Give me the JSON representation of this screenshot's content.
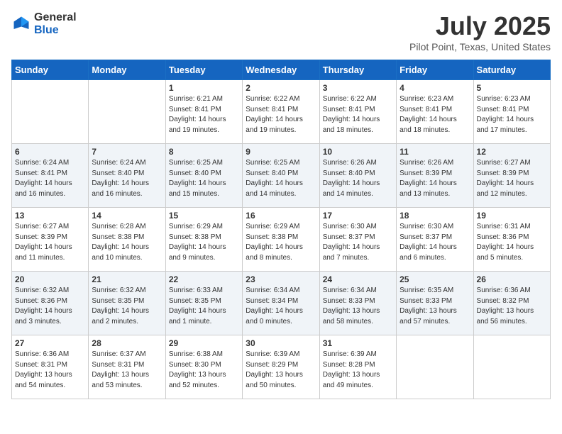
{
  "logo": {
    "text1": "General",
    "text2": "Blue"
  },
  "title": "July 2025",
  "subtitle": "Pilot Point, Texas, United States",
  "weekdays": [
    "Sunday",
    "Monday",
    "Tuesday",
    "Wednesday",
    "Thursday",
    "Friday",
    "Saturday"
  ],
  "weeks": [
    [
      {
        "day": "",
        "sunrise": "",
        "sunset": "",
        "daylight": ""
      },
      {
        "day": "",
        "sunrise": "",
        "sunset": "",
        "daylight": ""
      },
      {
        "day": "1",
        "sunrise": "Sunrise: 6:21 AM",
        "sunset": "Sunset: 8:41 PM",
        "daylight": "Daylight: 14 hours and 19 minutes."
      },
      {
        "day": "2",
        "sunrise": "Sunrise: 6:22 AM",
        "sunset": "Sunset: 8:41 PM",
        "daylight": "Daylight: 14 hours and 19 minutes."
      },
      {
        "day": "3",
        "sunrise": "Sunrise: 6:22 AM",
        "sunset": "Sunset: 8:41 PM",
        "daylight": "Daylight: 14 hours and 18 minutes."
      },
      {
        "day": "4",
        "sunrise": "Sunrise: 6:23 AM",
        "sunset": "Sunset: 8:41 PM",
        "daylight": "Daylight: 14 hours and 18 minutes."
      },
      {
        "day": "5",
        "sunrise": "Sunrise: 6:23 AM",
        "sunset": "Sunset: 8:41 PM",
        "daylight": "Daylight: 14 hours and 17 minutes."
      }
    ],
    [
      {
        "day": "6",
        "sunrise": "Sunrise: 6:24 AM",
        "sunset": "Sunset: 8:41 PM",
        "daylight": "Daylight: 14 hours and 16 minutes."
      },
      {
        "day": "7",
        "sunrise": "Sunrise: 6:24 AM",
        "sunset": "Sunset: 8:40 PM",
        "daylight": "Daylight: 14 hours and 16 minutes."
      },
      {
        "day": "8",
        "sunrise": "Sunrise: 6:25 AM",
        "sunset": "Sunset: 8:40 PM",
        "daylight": "Daylight: 14 hours and 15 minutes."
      },
      {
        "day": "9",
        "sunrise": "Sunrise: 6:25 AM",
        "sunset": "Sunset: 8:40 PM",
        "daylight": "Daylight: 14 hours and 14 minutes."
      },
      {
        "day": "10",
        "sunrise": "Sunrise: 6:26 AM",
        "sunset": "Sunset: 8:40 PM",
        "daylight": "Daylight: 14 hours and 14 minutes."
      },
      {
        "day": "11",
        "sunrise": "Sunrise: 6:26 AM",
        "sunset": "Sunset: 8:39 PM",
        "daylight": "Daylight: 14 hours and 13 minutes."
      },
      {
        "day": "12",
        "sunrise": "Sunrise: 6:27 AM",
        "sunset": "Sunset: 8:39 PM",
        "daylight": "Daylight: 14 hours and 12 minutes."
      }
    ],
    [
      {
        "day": "13",
        "sunrise": "Sunrise: 6:27 AM",
        "sunset": "Sunset: 8:39 PM",
        "daylight": "Daylight: 14 hours and 11 minutes."
      },
      {
        "day": "14",
        "sunrise": "Sunrise: 6:28 AM",
        "sunset": "Sunset: 8:38 PM",
        "daylight": "Daylight: 14 hours and 10 minutes."
      },
      {
        "day": "15",
        "sunrise": "Sunrise: 6:29 AM",
        "sunset": "Sunset: 8:38 PM",
        "daylight": "Daylight: 14 hours and 9 minutes."
      },
      {
        "day": "16",
        "sunrise": "Sunrise: 6:29 AM",
        "sunset": "Sunset: 8:38 PM",
        "daylight": "Daylight: 14 hours and 8 minutes."
      },
      {
        "day": "17",
        "sunrise": "Sunrise: 6:30 AM",
        "sunset": "Sunset: 8:37 PM",
        "daylight": "Daylight: 14 hours and 7 minutes."
      },
      {
        "day": "18",
        "sunrise": "Sunrise: 6:30 AM",
        "sunset": "Sunset: 8:37 PM",
        "daylight": "Daylight: 14 hours and 6 minutes."
      },
      {
        "day": "19",
        "sunrise": "Sunrise: 6:31 AM",
        "sunset": "Sunset: 8:36 PM",
        "daylight": "Daylight: 14 hours and 5 minutes."
      }
    ],
    [
      {
        "day": "20",
        "sunrise": "Sunrise: 6:32 AM",
        "sunset": "Sunset: 8:36 PM",
        "daylight": "Daylight: 14 hours and 3 minutes."
      },
      {
        "day": "21",
        "sunrise": "Sunrise: 6:32 AM",
        "sunset": "Sunset: 8:35 PM",
        "daylight": "Daylight: 14 hours and 2 minutes."
      },
      {
        "day": "22",
        "sunrise": "Sunrise: 6:33 AM",
        "sunset": "Sunset: 8:35 PM",
        "daylight": "Daylight: 14 hours and 1 minute."
      },
      {
        "day": "23",
        "sunrise": "Sunrise: 6:34 AM",
        "sunset": "Sunset: 8:34 PM",
        "daylight": "Daylight: 14 hours and 0 minutes."
      },
      {
        "day": "24",
        "sunrise": "Sunrise: 6:34 AM",
        "sunset": "Sunset: 8:33 PM",
        "daylight": "Daylight: 13 hours and 58 minutes."
      },
      {
        "day": "25",
        "sunrise": "Sunrise: 6:35 AM",
        "sunset": "Sunset: 8:33 PM",
        "daylight": "Daylight: 13 hours and 57 minutes."
      },
      {
        "day": "26",
        "sunrise": "Sunrise: 6:36 AM",
        "sunset": "Sunset: 8:32 PM",
        "daylight": "Daylight: 13 hours and 56 minutes."
      }
    ],
    [
      {
        "day": "27",
        "sunrise": "Sunrise: 6:36 AM",
        "sunset": "Sunset: 8:31 PM",
        "daylight": "Daylight: 13 hours and 54 minutes."
      },
      {
        "day": "28",
        "sunrise": "Sunrise: 6:37 AM",
        "sunset": "Sunset: 8:31 PM",
        "daylight": "Daylight: 13 hours and 53 minutes."
      },
      {
        "day": "29",
        "sunrise": "Sunrise: 6:38 AM",
        "sunset": "Sunset: 8:30 PM",
        "daylight": "Daylight: 13 hours and 52 minutes."
      },
      {
        "day": "30",
        "sunrise": "Sunrise: 6:39 AM",
        "sunset": "Sunset: 8:29 PM",
        "daylight": "Daylight: 13 hours and 50 minutes."
      },
      {
        "day": "31",
        "sunrise": "Sunrise: 6:39 AM",
        "sunset": "Sunset: 8:28 PM",
        "daylight": "Daylight: 13 hours and 49 minutes."
      },
      {
        "day": "",
        "sunrise": "",
        "sunset": "",
        "daylight": ""
      },
      {
        "day": "",
        "sunrise": "",
        "sunset": "",
        "daylight": ""
      }
    ]
  ]
}
